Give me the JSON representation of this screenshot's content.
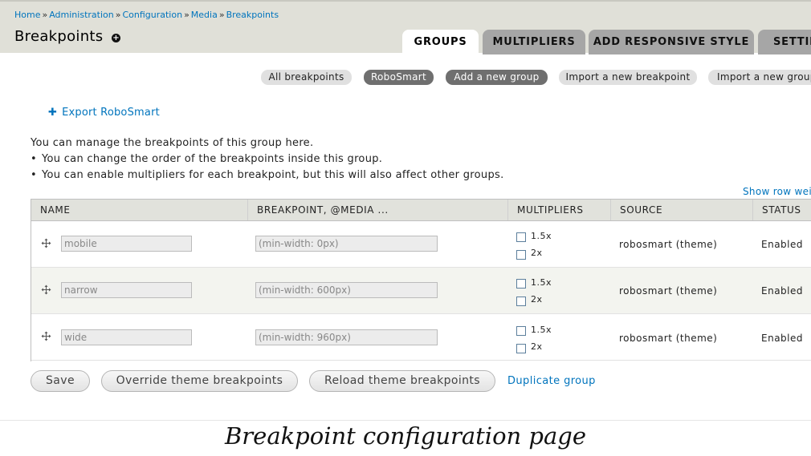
{
  "breadcrumb": [
    "Home",
    "Administration",
    "Configuration",
    "Media",
    "Breakpoints"
  ],
  "breadcrumb_sep": "»",
  "page_title": "Breakpoints",
  "tabs": [
    {
      "label": "GROUPS",
      "active": true
    },
    {
      "label": "MULTIPLIERS",
      "active": false
    },
    {
      "label": "ADD RESPONSIVE STYLE",
      "active": false
    },
    {
      "label": "SETTIN",
      "active": false
    }
  ],
  "actions": [
    {
      "label": "All breakpoints",
      "active": false
    },
    {
      "label": "RoboSmart",
      "active": true
    },
    {
      "label": "Add a new group",
      "active": true
    },
    {
      "label": "Import a new breakpoint",
      "active": false
    },
    {
      "label": "Import a new group",
      "active": false
    }
  ],
  "export_link": "Export RoboSmart",
  "description": {
    "intro": "You can manage the breakpoints of this group here.",
    "bullets": [
      "You can change the order of the breakpoints inside this group.",
      "You can enable multipliers for each breakpoint, but this will also affect other groups."
    ]
  },
  "show_row_weights": "Show row weig",
  "table": {
    "headers": [
      "NAME",
      "BREAKPOINT, @MEDIA ...",
      "MULTIPLIERS",
      "SOURCE",
      "STATUS"
    ],
    "rows": [
      {
        "name": "mobile",
        "media": "(min-width: 0px)",
        "multipliers": [
          "1.5x",
          "2x"
        ],
        "source": "robosmart (theme)",
        "status": "Enabled"
      },
      {
        "name": "narrow",
        "media": "(min-width: 600px)",
        "multipliers": [
          "1.5x",
          "2x"
        ],
        "source": "robosmart (theme)",
        "status": "Enabled"
      },
      {
        "name": "wide",
        "media": "(min-width: 960px)",
        "multipliers": [
          "1.5x",
          "2x"
        ],
        "source": "robosmart (theme)",
        "status": "Enabled"
      }
    ]
  },
  "buttons": {
    "save": "Save",
    "override": "Override theme breakpoints",
    "reload": "Reload theme breakpoints",
    "duplicate": "Duplicate group"
  },
  "caption": "Breakpoint configuration page",
  "colors": {
    "link": "#0074bd",
    "header_bg": "#e0e0d8",
    "tab_inactive": "#a6a6a6",
    "pill_active": "#6f6f6f"
  },
  "icons": {
    "title_add": "plus-circle-icon",
    "row_drag": "move-arrows-icon",
    "export": "plus-icon"
  }
}
